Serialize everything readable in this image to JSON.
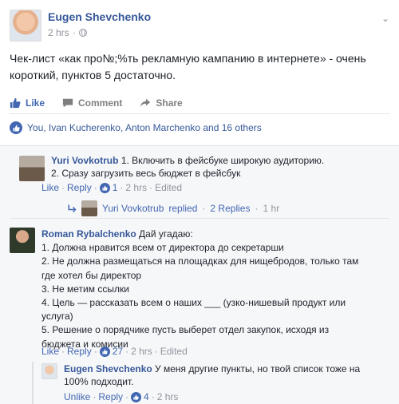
{
  "post": {
    "author": "Eugen Shevchenko",
    "time": "2 hrs",
    "separator": "·",
    "text": "Чек-лист «как про№;%ть рекламную кампанию в интернете» - очень короткий, пунктов 5 достаточно."
  },
  "actions": {
    "like": "Like",
    "comment": "Comment",
    "share": "Share"
  },
  "reactions": {
    "summary": "You, Ivan Kucherenko, Anton Marchenko and 16 others"
  },
  "comments": [
    {
      "author": "Yuri Vovkotrub",
      "lines": [
        "1. Включить в фейсбуке широкую аудиторию.",
        "2. Сразу загрузить весь бюджет в фейсбук"
      ],
      "like": "Like",
      "reply": "Reply",
      "likes": "1",
      "time": "2 hrs",
      "edited": "Edited",
      "reply_summary": {
        "author": "Yuri Vovkotrub",
        "text": "replied",
        "count": "2 Replies",
        "time": "1 hr"
      }
    },
    {
      "author": "Roman Rybalchenko",
      "first": "Дай угадаю:",
      "lines": [
        "1. Должна нравится всем от директора до секретарши",
        "2. Не должна размещаться на площадках для нищебродов, только там",
        "где хотел бы директор",
        "3. Не метим ссылки",
        "4. Цель — рассказать всем о наших ___ (узко-нишевый продукт или",
        "услуга)",
        "5. Решение о порядчике пусть выберет отдел закупок, исходя из",
        "бюджета и комисии"
      ],
      "like": "Like",
      "reply": "Reply",
      "likes": "27",
      "time": "2 hrs",
      "edited": "Edited"
    }
  ],
  "reply": {
    "author": "Eugen Shevchenko",
    "text1": "У меня другие пункты, но твой список тоже на",
    "text2": "100% подходит.",
    "unlike": "Unlike",
    "reply": "Reply",
    "likes": "4",
    "time": "2 hrs"
  },
  "colors": {
    "link": "#365899",
    "accent": "#4267b2",
    "meta": "#90949c"
  }
}
